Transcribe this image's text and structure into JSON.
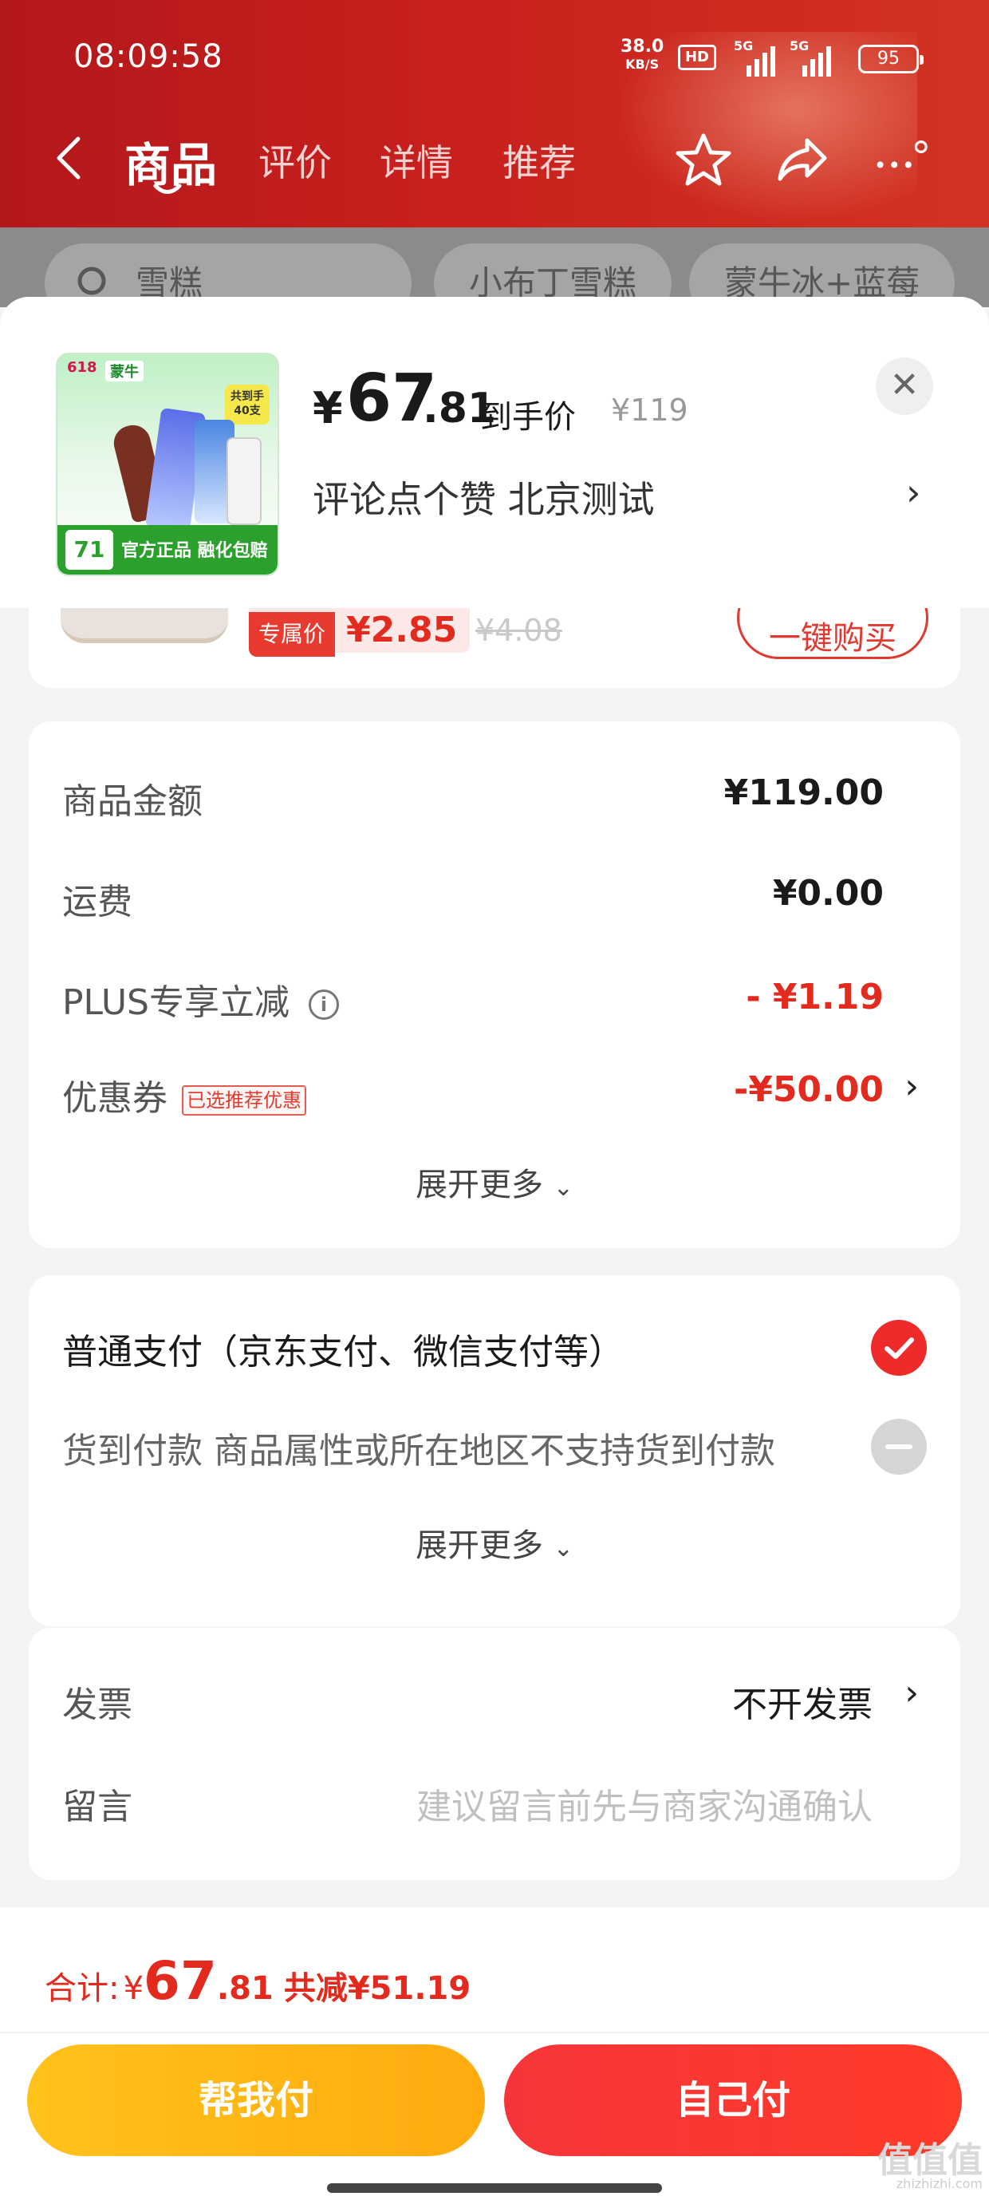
{
  "status_bar": {
    "time": "08:09:58",
    "net_speed": "38.0",
    "net_unit": "KB/S",
    "hd": "HD",
    "sim1": "5G",
    "sim2": "5G",
    "battery": "95"
  },
  "nav": {
    "tabs": [
      "商品",
      "评价",
      "详情",
      "推荐"
    ],
    "active_tab": "商品"
  },
  "background_chips": [
    "雪糕",
    "小布丁雪糕",
    "蒙牛冰+蓝莓"
  ],
  "product": {
    "price_symbol": "¥",
    "price_integer": "67",
    "price_decimal": ".81",
    "price_label": "到手价",
    "original_price": "¥119",
    "variant": "评论点个赞  北京测试",
    "thumbnail": {
      "badge_618": "618",
      "brand": "蒙牛",
      "count_badge": "共到手 40支",
      "price_badge": "71",
      "caption": "官方正品 融化包赔"
    }
  },
  "recommended": {
    "tag_label": "专属价",
    "tag_price": "¥2.85",
    "original_price": "¥4.08",
    "button_label": "一键购买"
  },
  "cost_breakdown": {
    "rows": [
      {
        "label": "商品金额",
        "value": "¥119.00"
      },
      {
        "label": "运费",
        "value": "¥0.00"
      },
      {
        "label": "PLUS专享立减",
        "value": "- ¥1.19"
      },
      {
        "label": "优惠券",
        "value": "-¥50.00",
        "tag": "已选推荐优惠"
      }
    ],
    "expand_label": "展开更多"
  },
  "payment": {
    "options": [
      {
        "label": "普通支付（京东支付、微信支付等）",
        "selected": true
      },
      {
        "label": "货到付款 商品属性或所在地区不支持货到付款",
        "selected": false
      }
    ],
    "expand_label": "展开更多"
  },
  "extras": {
    "invoice_label": "发票",
    "invoice_value": "不开发票",
    "note_label": "留言",
    "note_placeholder": "建议留言前先与商家沟通确认"
  },
  "summary": {
    "total_label": "合计:",
    "total_symbol": "¥",
    "total_integer": "67",
    "total_decimal": ".81",
    "savings": "共减¥51.19"
  },
  "actions": {
    "help_pay": "帮我付",
    "self_pay": "自己付"
  },
  "watermark": {
    "main": "值值值",
    "sub": "zhizhizhi.com"
  },
  "colors": {
    "accent_red": "#e22a1e",
    "header_red": "#c8201d",
    "help_button": "#ffb814",
    "self_button": "#f6353a"
  }
}
